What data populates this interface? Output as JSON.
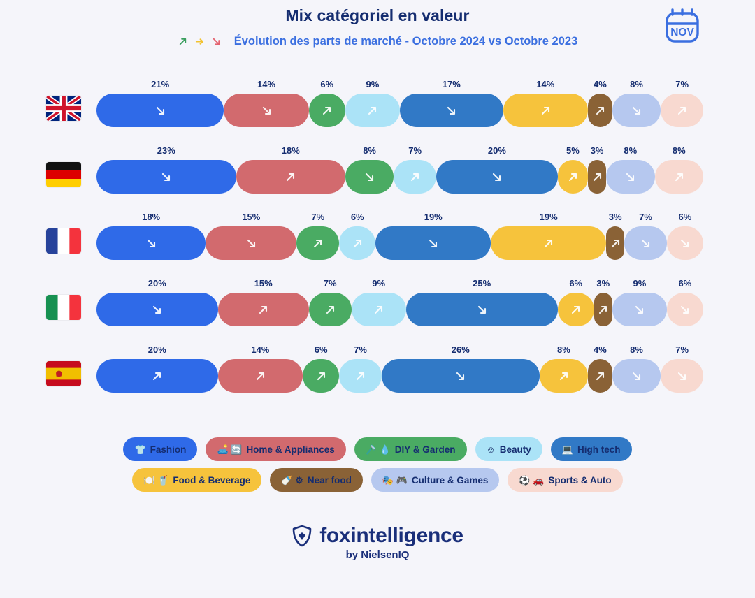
{
  "header": {
    "title": "Mix catégoriel en valeur",
    "subtitle": "Évolution des parts de marché - Octobre 2024 vs Octobre 2023",
    "calendar_month": "NOV",
    "trend_legend": [
      {
        "name": "up",
        "color": "#3a9e5e"
      },
      {
        "name": "flat",
        "color": "#f2c230"
      },
      {
        "name": "down",
        "color": "#e4626f"
      }
    ]
  },
  "footer": {
    "brand": "foxintelligence",
    "brand_sub": "by NielsenIQ"
  },
  "legend": {
    "rows": [
      [
        {
          "label": "Fashion",
          "color": "#2f6ae8",
          "text_color": "#152d70",
          "glyphs": "👕"
        },
        {
          "label": "Home & Appliances",
          "color": "#d26a6e",
          "text_color": "#152d70",
          "glyphs": "🛋️ 🔄"
        },
        {
          "label": "DIY & Garden",
          "color": "#4aab63",
          "text_color": "#152d70",
          "glyphs": "🪒 💧"
        },
        {
          "label": "Beauty",
          "color": "#abe3f7",
          "text_color": "#152d70",
          "glyphs": "☺"
        },
        {
          "label": "High tech",
          "color": "#3179c6",
          "text_color": "#152d70",
          "glyphs": "💻"
        }
      ],
      [
        {
          "label": "Food & Beverage",
          "color": "#f6c33c",
          "text_color": "#152d70",
          "glyphs": "🍽️ 🥤"
        },
        {
          "label": "Near food",
          "color": "#8a6236",
          "text_color": "#152d70",
          "glyphs": "🍼 ⚙"
        },
        {
          "label": "Culture & Games",
          "color": "#b6c8ef",
          "text_color": "#152d70",
          "glyphs": "🎭 🎮"
        },
        {
          "label": "Sports & Auto",
          "color": "#f8d9d0",
          "text_color": "#152d70",
          "glyphs": "⚽ 🚗"
        }
      ]
    ]
  },
  "chart_data": {
    "type": "bar",
    "subtype": "stacked-horizontal-100",
    "title": "Mix catégoriel en valeur",
    "subtitle": "Évolution des parts de marché - Octobre 2024 vs Octobre 2023",
    "xlabel": "",
    "ylabel": "",
    "unit": "%",
    "xlim": [
      0,
      100
    ],
    "grid": false,
    "legend_position": "bottom",
    "categories": [
      "Fashion",
      "Home & Appliances",
      "DIY & Garden",
      "Beauty",
      "High tech",
      "Food & Beverage",
      "Near food",
      "Culture & Games",
      "Sports & Auto"
    ],
    "category_colors": [
      "#2f6ae8",
      "#d26a6e",
      "#4aab63",
      "#abe3f7",
      "#3179c6",
      "#f6c33c",
      "#8a6236",
      "#b6c8ef",
      "#f8d9d0"
    ],
    "countries": [
      "United Kingdom",
      "Germany",
      "France",
      "Italy",
      "Spain"
    ],
    "country_flags": [
      "gb",
      "de",
      "fr",
      "it",
      "es"
    ],
    "series": [
      {
        "name": "United Kingdom",
        "flag": "gb",
        "values": [
          21,
          14,
          6,
          9,
          17,
          14,
          4,
          8,
          7
        ],
        "labels": [
          "21%",
          "14%",
          "6%",
          "9%",
          "17%",
          "14%",
          "4%",
          "8%",
          "7%"
        ],
        "trends": [
          "down",
          "down",
          "up",
          "up",
          "down",
          "up",
          "up",
          "down",
          "up"
        ]
      },
      {
        "name": "Germany",
        "flag": "de",
        "values": [
          23,
          18,
          8,
          7,
          20,
          5,
          3,
          8,
          8
        ],
        "labels": [
          "23%",
          "18%",
          "8%",
          "7%",
          "20%",
          "5%",
          "3%",
          "8%",
          "8%"
        ],
        "trends": [
          "down",
          "up",
          "down",
          "up",
          "down",
          "up",
          "up",
          "down",
          "up"
        ]
      },
      {
        "name": "France",
        "flag": "fr",
        "values": [
          18,
          15,
          7,
          6,
          19,
          19,
          3,
          7,
          6
        ],
        "labels": [
          "18%",
          "15%",
          "7%",
          "6%",
          "19%",
          "19%",
          "3%",
          "7%",
          "6%"
        ],
        "trends": [
          "down",
          "down",
          "up",
          "up",
          "down",
          "up",
          "up",
          "down",
          "down"
        ]
      },
      {
        "name": "Italy",
        "flag": "it",
        "values": [
          20,
          15,
          7,
          9,
          25,
          6,
          3,
          9,
          6
        ],
        "labels": [
          "20%",
          "15%",
          "7%",
          "9%",
          "25%",
          "6%",
          "3%",
          "9%",
          "6%"
        ],
        "trends": [
          "down",
          "up",
          "up",
          "up",
          "down",
          "up",
          "up",
          "down",
          "down"
        ]
      },
      {
        "name": "Spain",
        "flag": "es",
        "values": [
          20,
          14,
          6,
          7,
          26,
          8,
          4,
          8,
          7
        ],
        "labels": [
          "20%",
          "14%",
          "6%",
          "7%",
          "26%",
          "8%",
          "4%",
          "8%",
          "7%"
        ],
        "trends": [
          "up",
          "up",
          "up",
          "up",
          "down",
          "up",
          "up",
          "down",
          "down"
        ]
      }
    ]
  }
}
